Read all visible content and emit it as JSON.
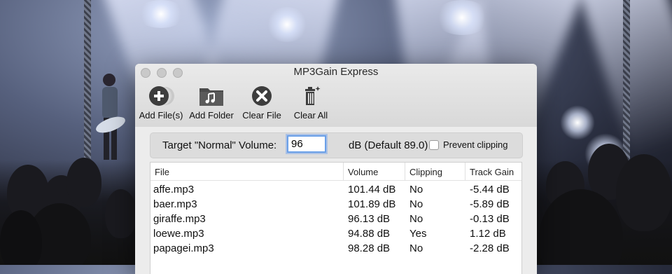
{
  "window": {
    "title": "MP3Gain Express"
  },
  "toolbar": {
    "items": [
      {
        "label": "Add File(s)",
        "icon": "plus-circle-icon"
      },
      {
        "label": "Add Folder",
        "icon": "music-folder-icon"
      },
      {
        "label": "Clear File",
        "icon": "x-circle-icon"
      },
      {
        "label": "Clear All",
        "icon": "trash-sparkle-icon"
      }
    ]
  },
  "target": {
    "label": "Target \"Normal\" Volume:",
    "value": "96",
    "default_text": "dB (Default 89.0)",
    "prevent_clipping_label": "Prevent clipping",
    "prevent_clipping_checked": false
  },
  "table": {
    "columns": [
      "File",
      "Volume",
      "Clipping",
      "Track Gain"
    ],
    "rows": [
      [
        "affe.mp3",
        "101.44 dB",
        "No",
        "-5.44 dB"
      ],
      [
        "baer.mp3",
        "101.89 dB",
        "No",
        "-5.89 dB"
      ],
      [
        "giraffe.mp3",
        "96.13 dB",
        "No",
        "-0.13 dB"
      ],
      [
        "loewe.mp3",
        "94.88 dB",
        "Yes",
        "1.12 dB"
      ],
      [
        "papagei.mp3",
        "98.28 dB",
        "No",
        "-2.28 dB"
      ]
    ]
  },
  "colors": {
    "accent": "#6aa0e8",
    "window_bg": "#ececec"
  }
}
